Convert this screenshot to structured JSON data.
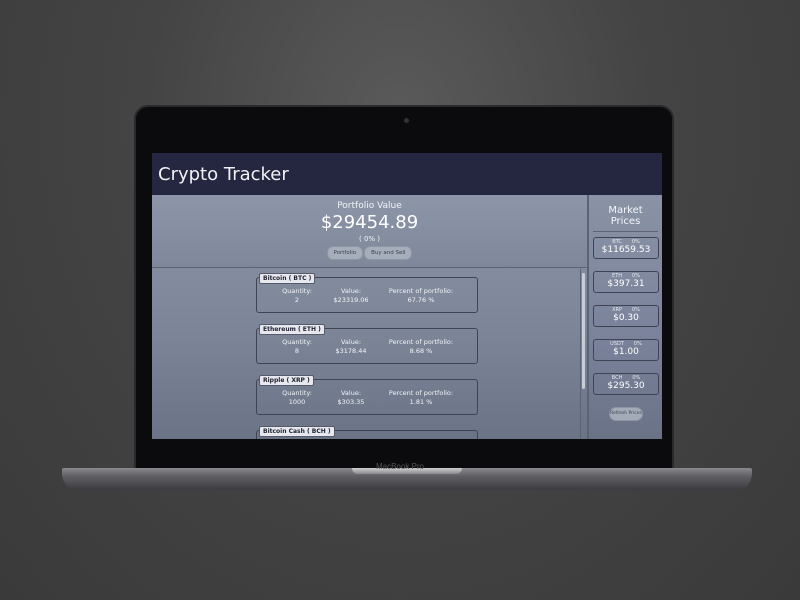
{
  "app": {
    "title": "Crypto Tracker"
  },
  "device": {
    "brand": "MacBook Pro"
  },
  "portfolio": {
    "label": "Portfolio Value",
    "value": "$29454.89",
    "change": "( 0% )",
    "tabs": [
      "Portfolio",
      "Buy and Sell"
    ]
  },
  "holdings_labels": {
    "quantity": "Quantity:",
    "value": "Value:",
    "percent": "Percent of portfolio:"
  },
  "holdings": [
    {
      "name": "Bitcoin ( BTC )",
      "quantity": "2",
      "value": "$23319.06",
      "percent": "67.76 %"
    },
    {
      "name": "Ethereum ( ETH )",
      "quantity": "8",
      "value": "$3178.44",
      "percent": "8.68 %"
    },
    {
      "name": "Ripple ( XRP )",
      "quantity": "1000",
      "value": "$303.35",
      "percent": "1.81 %"
    },
    {
      "name": "Bitcoin Cash ( BCH )",
      "quantity": "",
      "value": "",
      "percent": ""
    }
  ],
  "market": {
    "title": "Market Prices",
    "prices": [
      {
        "symbol": "BTC",
        "change": "0%",
        "price": "$11659.53"
      },
      {
        "symbol": "ETH",
        "change": "0%",
        "price": "$397.31"
      },
      {
        "symbol": "XRP",
        "change": "0%",
        "price": "$0.30"
      },
      {
        "symbol": "USDT",
        "change": "0%",
        "price": "$1.00"
      },
      {
        "symbol": "BCH",
        "change": "0%",
        "price": "$295.30"
      }
    ],
    "refresh_label": "Refresh Prices"
  }
}
